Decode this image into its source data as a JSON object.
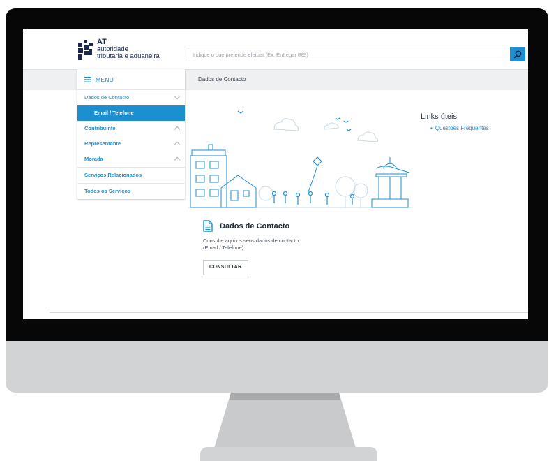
{
  "site": {
    "logo_acronym": "AT",
    "logo_line1": "autoridade",
    "logo_line2": "tributária e aduaneira"
  },
  "search": {
    "placeholder": "Indique o que pretende efetuar (Ex: Entregar IRS)",
    "icon": "search-icon"
  },
  "breadcrumb": "Dados de Contacto",
  "menu": {
    "title": "MENU",
    "items": [
      {
        "label": "Dados de Contacto",
        "chevron": "down"
      },
      {
        "label": "Email / Telefone",
        "active": true
      },
      {
        "label": "Contribuinte",
        "chevron": "up"
      },
      {
        "label": "Representante",
        "chevron": "up"
      },
      {
        "label": "Morada",
        "chevron": "up"
      },
      {
        "label": "Serviços Relacionados"
      },
      {
        "label": "Todos os Serviços"
      }
    ]
  },
  "links": {
    "title": "Links úteis",
    "items": [
      "Questões Frequentes"
    ]
  },
  "card": {
    "title": "Dados de Contacto",
    "description": "Consulte aqui os seus dados de contacto (Email / Telefone).",
    "button": "CONSULTAR"
  },
  "colors": {
    "accent": "#1b8fd0",
    "menu_bar": "#eef0f2",
    "text_dark": "#1e2a38"
  }
}
